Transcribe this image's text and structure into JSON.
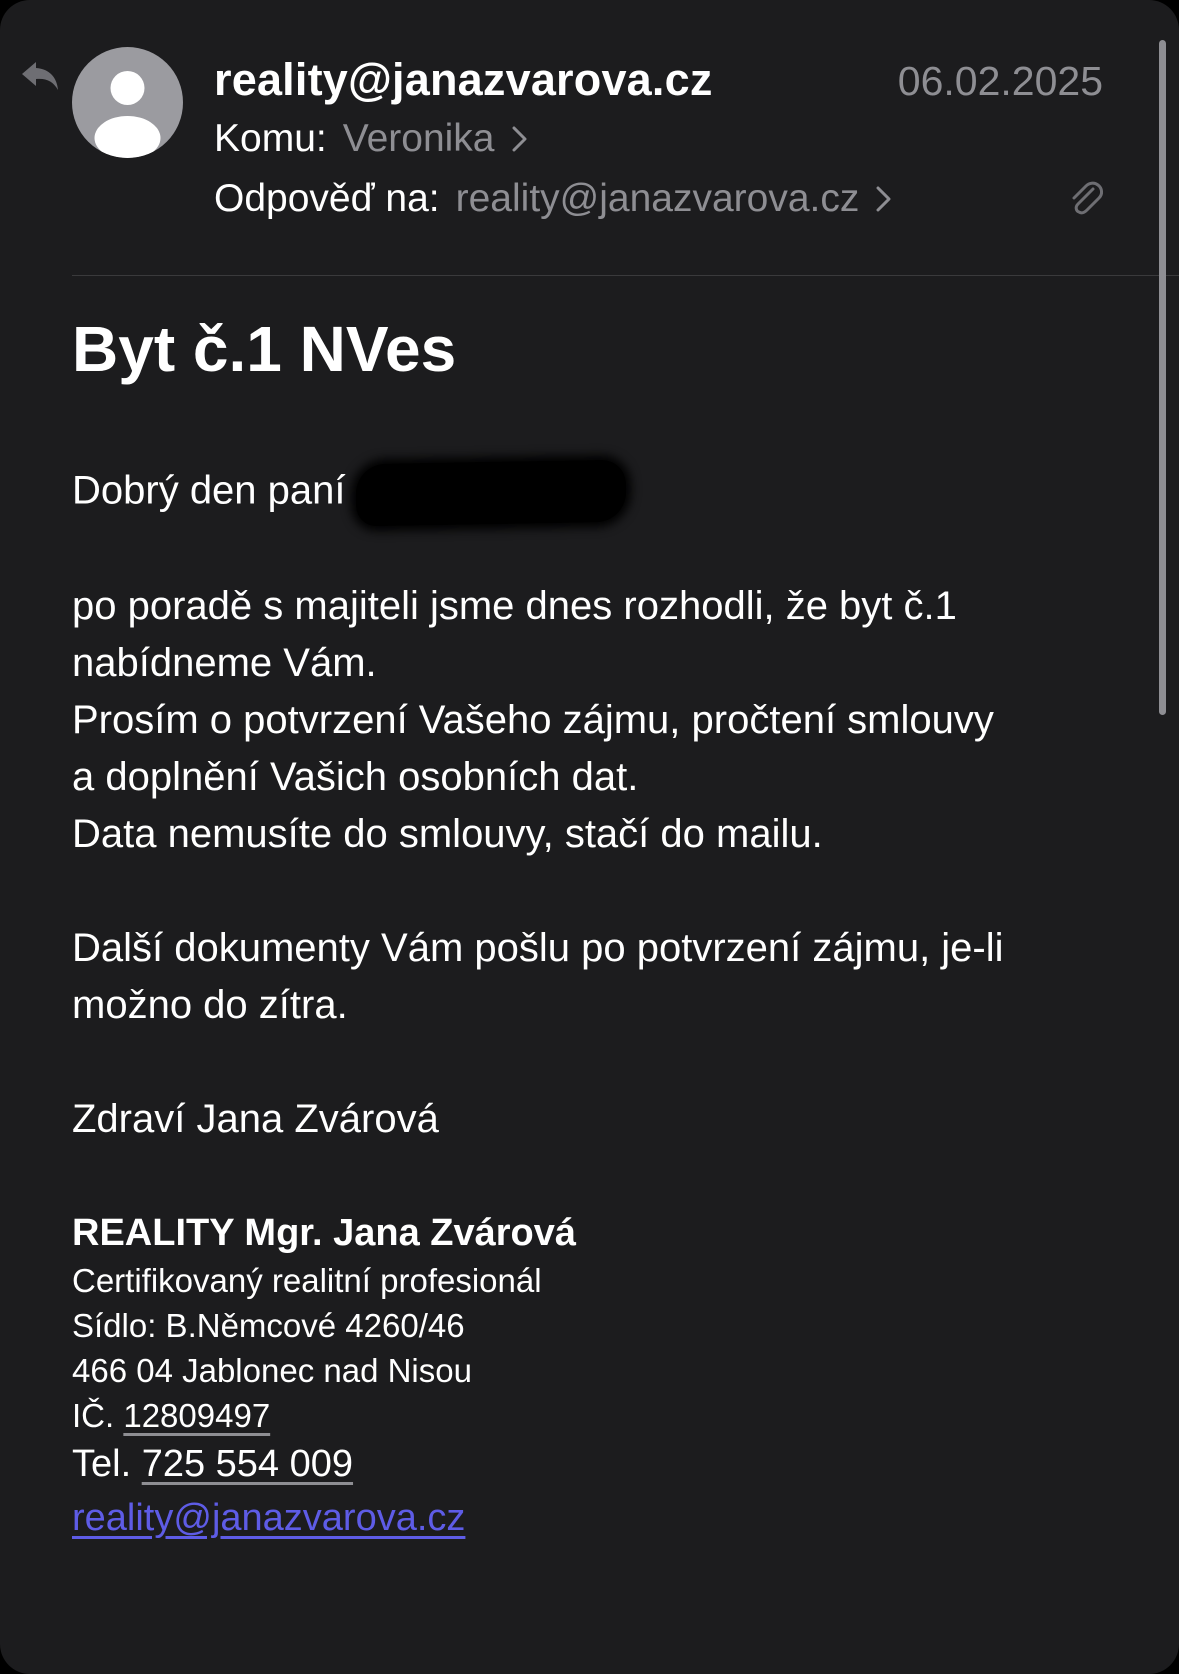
{
  "header": {
    "sender": "reality@janazvarova.cz",
    "date": "06.02.2025",
    "to_label": "Komu:",
    "to_value": "Veronika",
    "reply_label": "Odpověď na:",
    "reply_value": "reality@janazvarova.cz"
  },
  "icons": {
    "reply_indicator": "reply-arrow-icon",
    "avatar": "person-avatar-icon",
    "chevron": "chevron-right-icon",
    "attachment": "paperclip-icon"
  },
  "subject": "Byt č.1 NVes",
  "body": {
    "greeting": "Dobrý den paní",
    "p1_l1": "po poradě s majiteli jsme dnes rozhodli, že byt č.1",
    "p1_l2": "nabídneme Vám.",
    "p1_l3": "Prosím o potvrzení Vašeho zájmu, pročtení smlouvy",
    "p1_l4": "a doplnění Vašich osobních dat.",
    "p1_l5": "Data nemusíte do smlouvy, stačí do mailu.",
    "p2_l1": "Další dokumenty Vám pošlu po potvrzení zájmu, je-li",
    "p2_l2": "možno do zítra.",
    "closing": "Zdraví  Jana Zvárová"
  },
  "signature": {
    "title": "REALITY Mgr. Jana Zvárová",
    "line1": "Certifikovaný realitní profesionál",
    "line2": "Sídlo: B.Němcové 4260/46",
    "line3": "466 04 Jablonec nad Nisou",
    "ic_label": "IČ.",
    "ic_value": "12809497",
    "tel_label": "Tel.",
    "tel_value": "725 554 009",
    "email": "reality@janazvarova.cz"
  },
  "colors": {
    "background": "#1c1c1e",
    "text": "#ffffff",
    "secondary": "#8e8e93",
    "link": "#5e5ce6"
  }
}
